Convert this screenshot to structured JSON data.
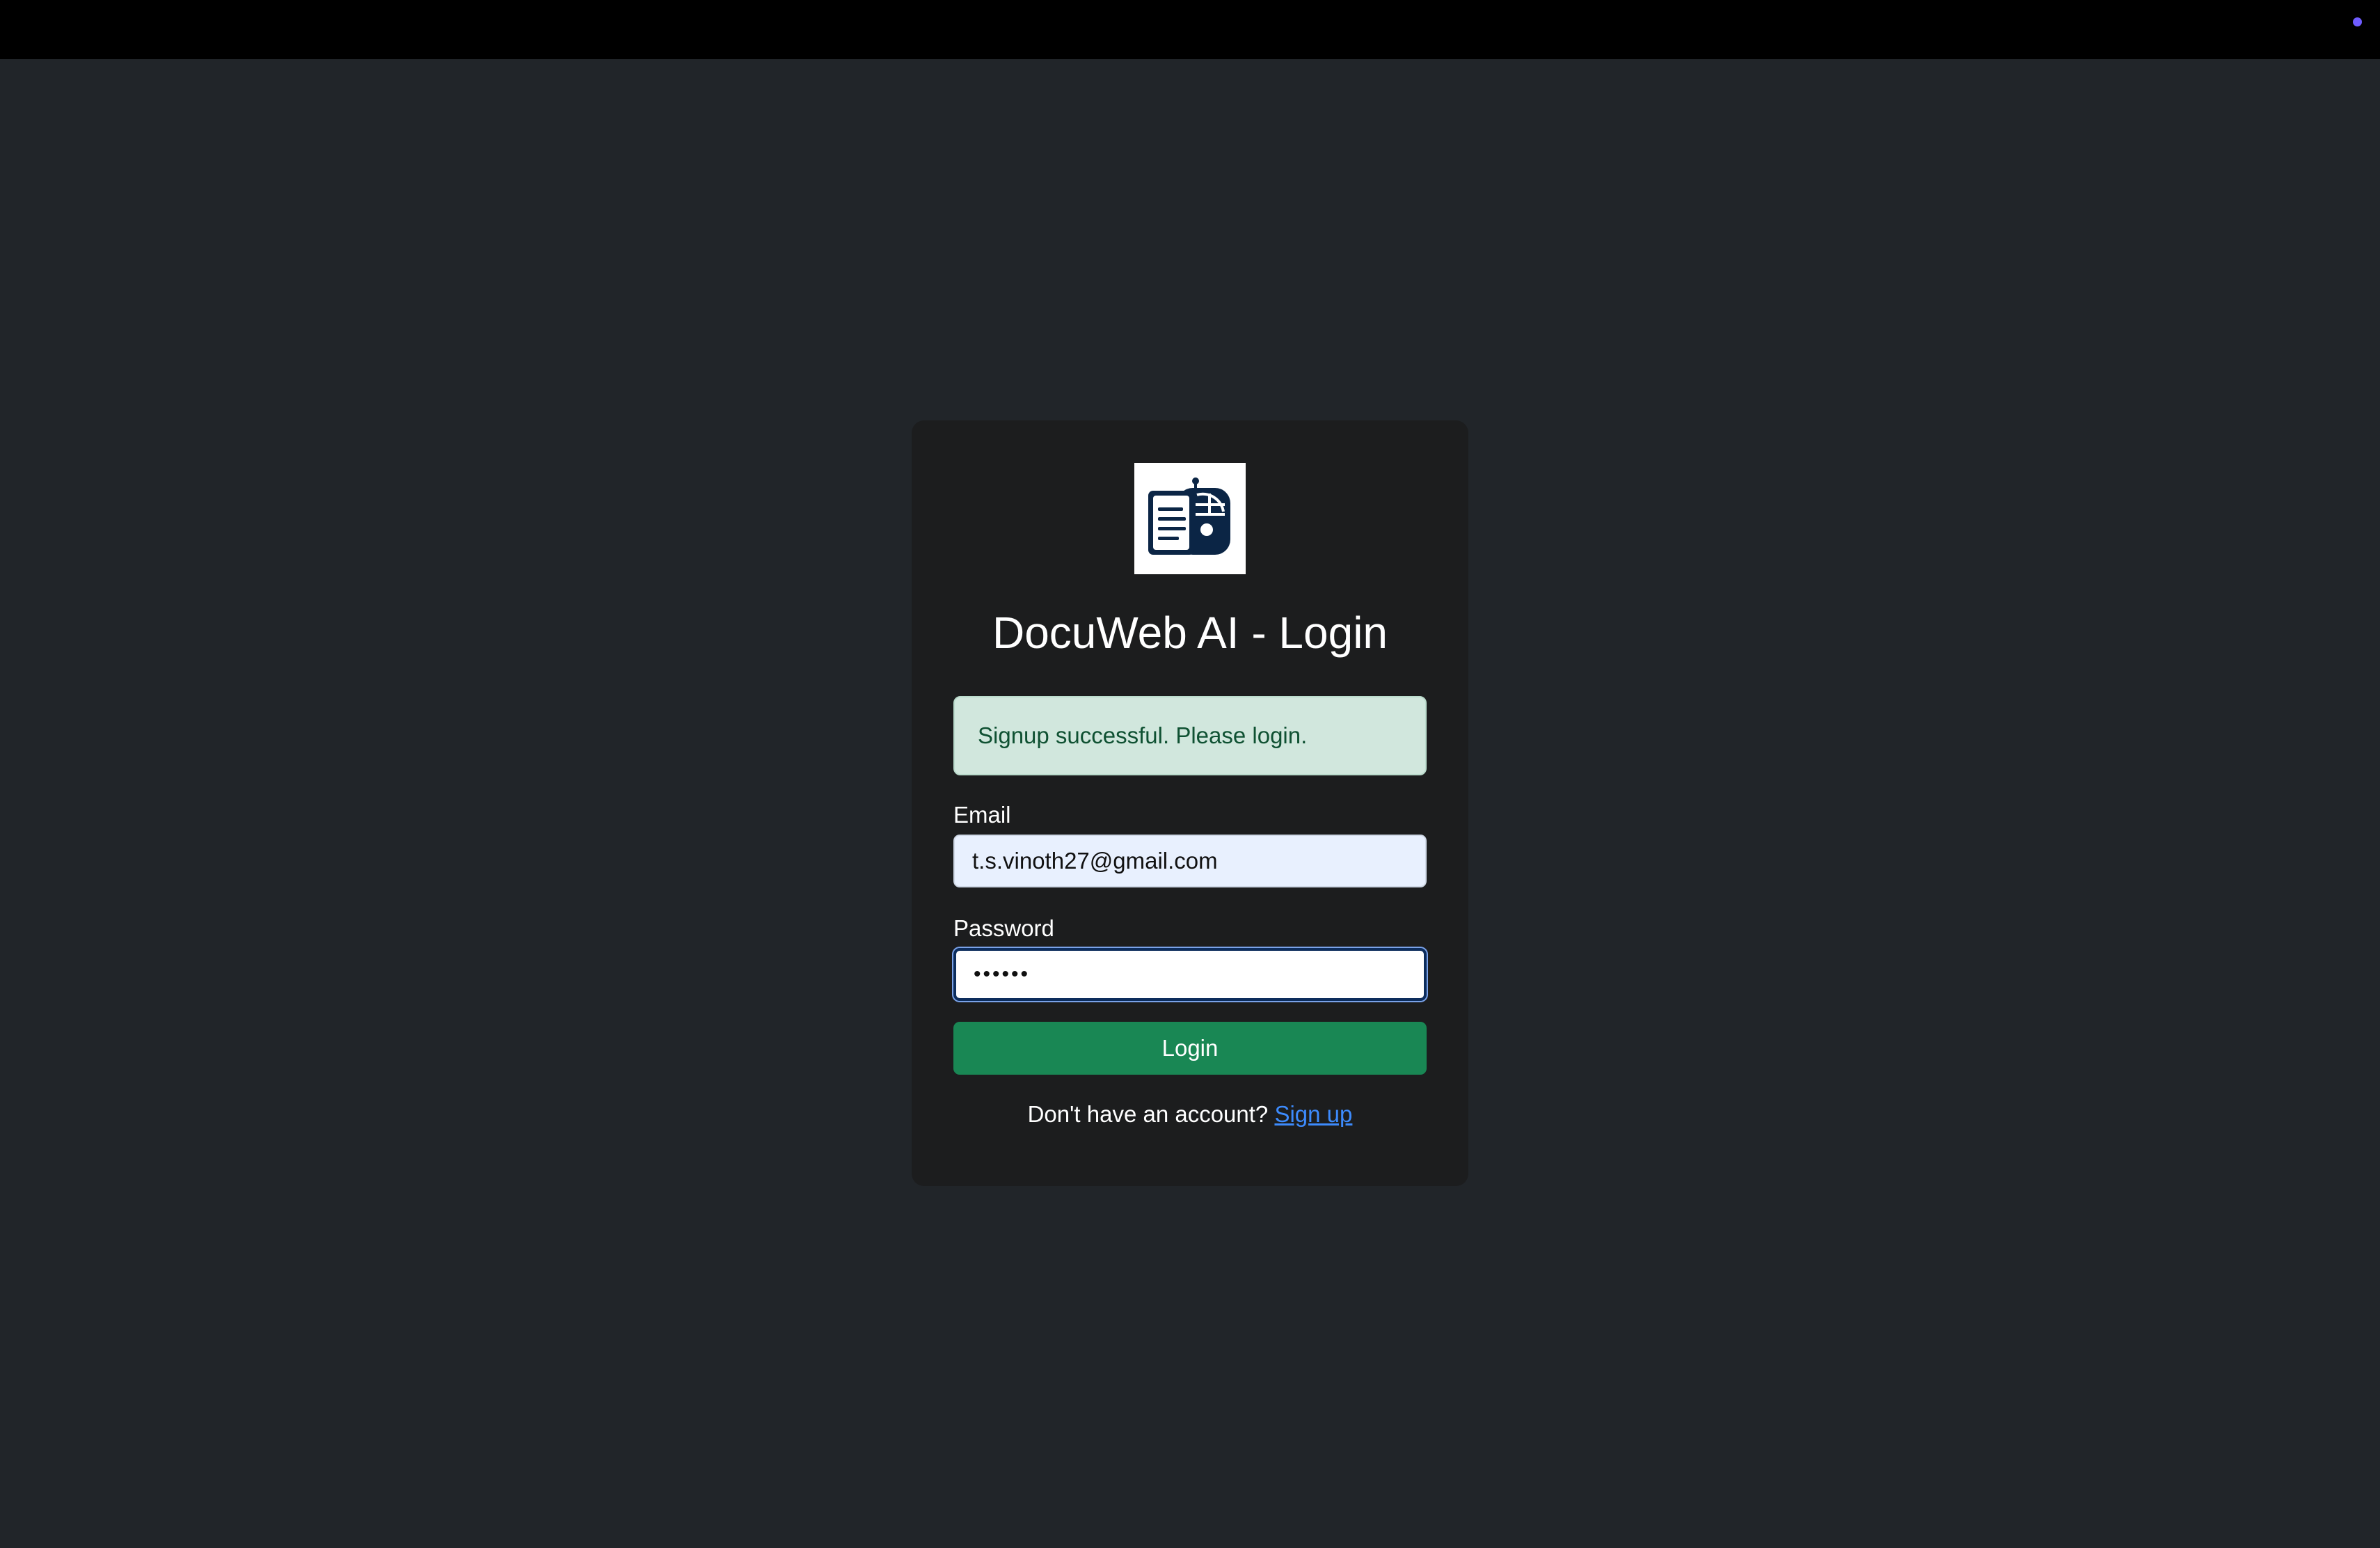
{
  "colors": {
    "page_background": "#212529",
    "card_background": "#1c1d1e",
    "alert_background": "#d1e7dd",
    "alert_text": "#0f5132",
    "button_green": "#198754",
    "link_blue": "#3d8bfd",
    "logo_navy": "#0b2545"
  },
  "header": {
    "logo_icon": "robot-document-icon",
    "title": "DocuWeb AI - Login"
  },
  "alert": {
    "message": "Signup successful. Please login."
  },
  "form": {
    "email_label": "Email",
    "email_value": "t.s.vinoth27@gmail.com",
    "password_label": "Password",
    "password_value": "••••••",
    "login_label": "Login"
  },
  "footer": {
    "prompt": "Don't have an account?",
    "signup_link": "Sign up"
  }
}
